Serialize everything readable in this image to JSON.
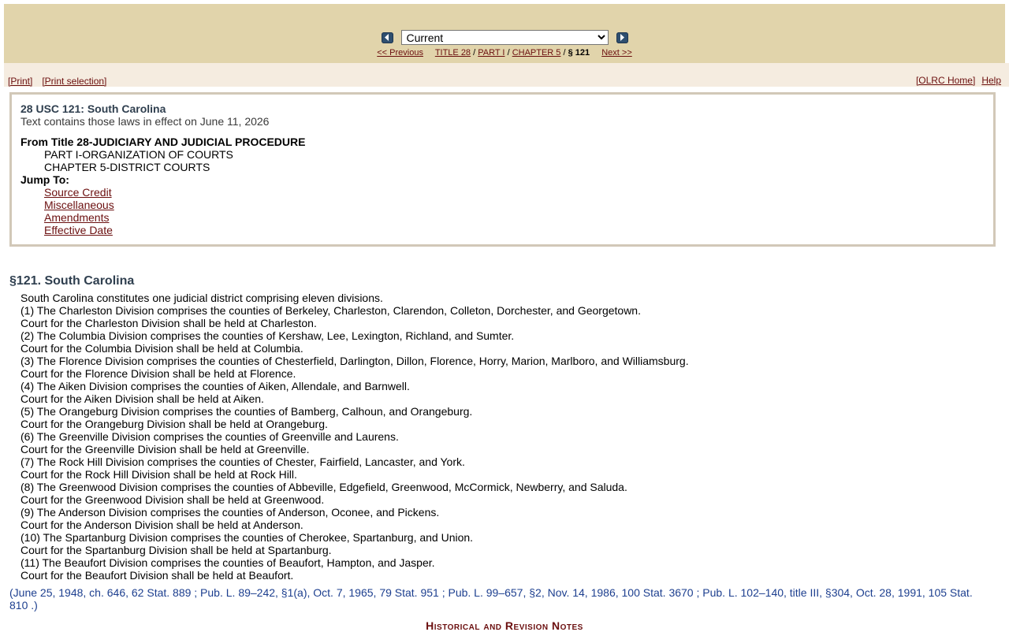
{
  "nav": {
    "prev_icon": "left-arrow-icon",
    "next_icon": "right-arrow-icon",
    "version_select": {
      "selected": "Current"
    },
    "breadcrumbs": {
      "previous": "<< Previous",
      "title": "TITLE 28",
      "sep1": "/",
      "part": "PART I",
      "sep2": "/",
      "chapter": "CHAPTER 5",
      "sep3": "/",
      "section": "§ 121",
      "next": "Next >>"
    }
  },
  "toolbar": {
    "print": "[Print]",
    "print_selection": "[Print selection]",
    "olrc_home": "[OLRC Home]",
    "help": "Help"
  },
  "info": {
    "title": "28 USC 121: South Carolina",
    "effect": "Text contains those laws in effect on June 11, 2026",
    "from": "From Title 28-JUDICIARY AND JUDICIAL PROCEDURE",
    "part": "PART I-ORGANIZATION OF COURTS",
    "chapter": "CHAPTER 5-DISTRICT COURTS",
    "jump_to_label": "Jump To:",
    "jump_links": [
      "Source Credit",
      "Miscellaneous",
      "Amendments",
      "Effective Date"
    ]
  },
  "section": {
    "heading": "§121. South Carolina",
    "lines": [
      "South Carolina constitutes one judicial district comprising eleven divisions.",
      "(1) The Charleston Division comprises the counties of Berkeley, Charleston, Clarendon, Colleton, Dorchester, and Georgetown.",
      "Court for the Charleston Division shall be held at Charleston.",
      "(2) The Columbia Division comprises the counties of Kershaw, Lee, Lexington, Richland, and Sumter.",
      "Court for the Columbia Division shall be held at Columbia.",
      "(3) The Florence Division comprises the counties of Chesterfield, Darlington, Dillon, Florence, Horry, Marion, Marlboro, and Williamsburg.",
      "Court for the Florence Division shall be held at Florence.",
      "(4) The Aiken Division comprises the counties of Aiken, Allendale, and Barnwell.",
      "Court for the Aiken Division shall be held at Aiken.",
      "(5) The Orangeburg Division comprises the counties of Bamberg, Calhoun, and Orangeburg.",
      "Court for the Orangeburg Division shall be held at Orangeburg.",
      "(6) The Greenville Division comprises the counties of Greenville and Laurens.",
      "Court for the Greenville Division shall be held at Greenville.",
      "(7) The Rock Hill Division comprises the counties of Chester, Fairfield, Lancaster, and York.",
      "Court for the Rock Hill Division shall be held at Rock Hill.",
      "(8) The Greenwood Division comprises the counties of Abbeville, Edgefield, Greenwood, McCormick, Newberry, and Saluda.",
      "Court for the Greenwood Division shall be held at Greenwood.",
      "(9) The Anderson Division comprises the counties of Anderson, Oconee, and Pickens.",
      "Court for the Anderson Division shall be held at Anderson.",
      "(10) The Spartanburg Division comprises the counties of Cherokee, Spartanburg, and Union.",
      "Court for the Spartanburg Division shall be held at Spartanburg.",
      "(11) The Beaufort Division comprises the counties of Beaufort, Hampton, and Jasper.",
      "Court for the Beaufort Division shall be held at Beaufort."
    ],
    "source_credit": "(June 25, 1948, ch. 646, 62 Stat. 889 ; Pub. L. 89–242, §1(a), Oct. 7, 1965, 79 Stat. 951 ; Pub. L. 99–657, §2, Nov. 14, 1986, 100 Stat. 3670 ; Pub. L. 102–140, title III, §304, Oct. 28, 1991, 105 Stat. 810 .)"
  },
  "notes_heading": "Historical and Revision Notes",
  "colors": {
    "header_bg": "#e1d4ab",
    "toolbar_bg": "#f5ece0",
    "link": "#6b0f0f",
    "heading": "#2f3f4f",
    "source_credit": "#1d3f8f"
  }
}
